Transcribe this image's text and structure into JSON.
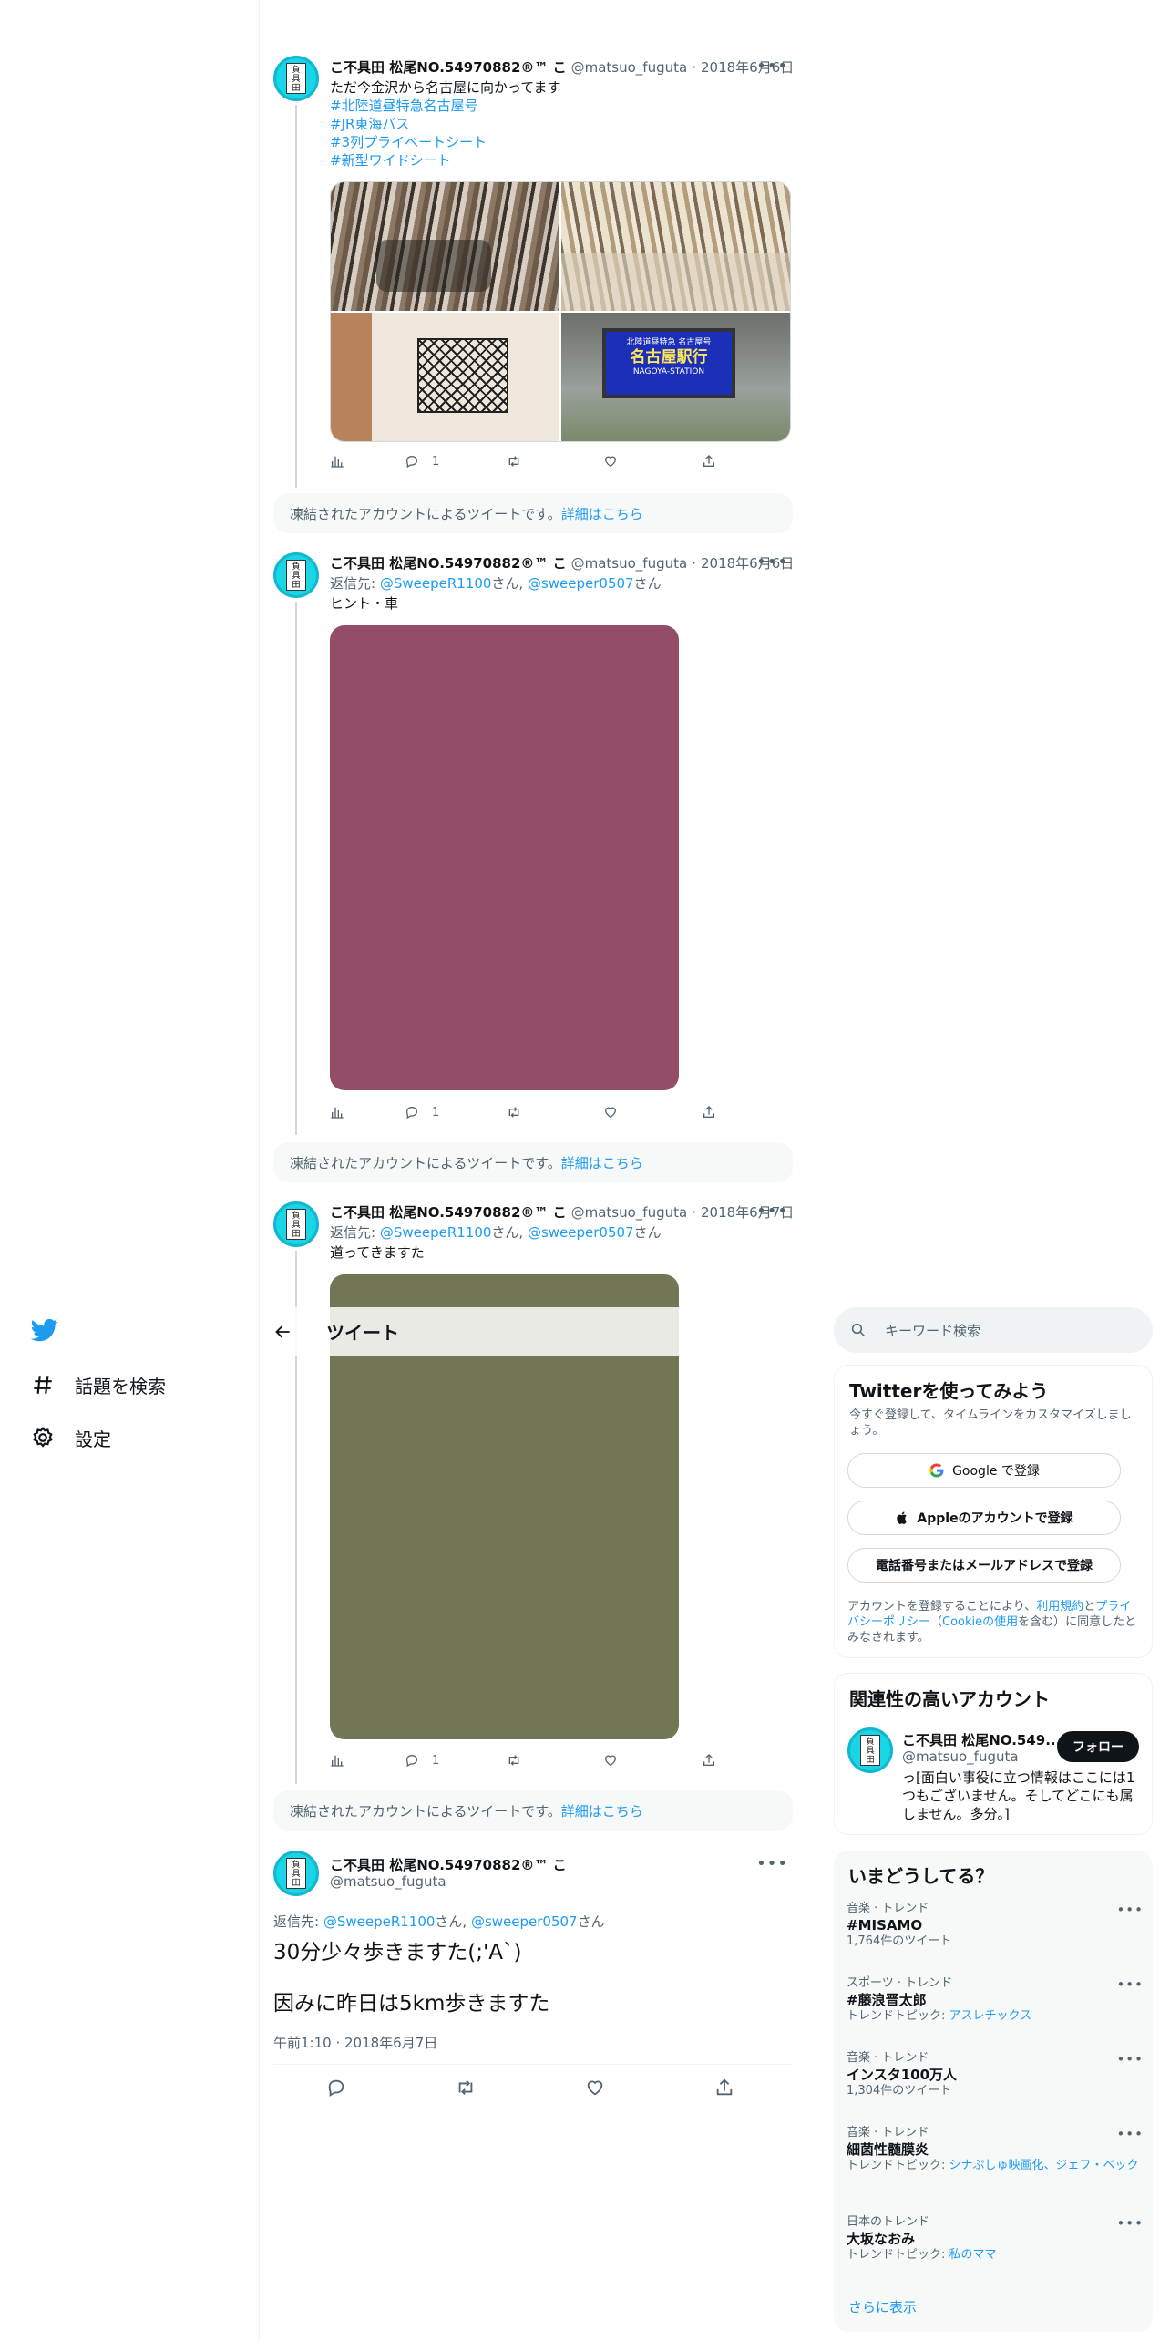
{
  "nav": {
    "items": [
      {
        "label": "話題を検索",
        "icon": "hashtag-icon"
      },
      {
        "label": "設定",
        "icon": "gear-icon"
      }
    ]
  },
  "header": {
    "title": "ツイート"
  },
  "tweets": [
    {
      "name": "こ不具田 松尾NO.54970882®™ こ",
      "handle": "@matsuo_fuguta",
      "dot": "·",
      "date": "2018年6月6日",
      "text": "ただ今金沢から名古屋に向かってます",
      "hashtags": [
        "#北陸道昼特急名古屋号",
        "#JR東海バス",
        "#3列プライベートシート",
        "#新型ワイドシート"
      ],
      "sign_lines": [
        "北陸道昼特急 名古屋号",
        "名古屋駅行",
        "NAGOYA-STATION"
      ],
      "reply_count": "1"
    },
    {
      "name": "こ不具田 松尾NO.54970882®™ こ",
      "handle": "@matsuo_fuguta",
      "dot": "·",
      "date": "2018年6月6日",
      "reply_prefix": "返信先: ",
      "reply_user1": "@SweepeR1100",
      "reply_mid": "さん, ",
      "reply_user2": "@sweeper0507",
      "reply_suffix": "さん",
      "text": "ヒント・車",
      "media_color": "#944d66",
      "reply_count": "1"
    },
    {
      "name": "こ不具田 松尾NO.54970882®™ こ",
      "handle": "@matsuo_fuguta",
      "dot": "·",
      "date": "2018年6月7日",
      "reply_prefix": "返信先: ",
      "reply_user1": "@SweepeR1100",
      "reply_mid": "さん, ",
      "reply_user2": "@sweeper0507",
      "reply_suffix": "さん",
      "text": "道ってきますた",
      "media_color": "#727654",
      "reply_count": "1"
    }
  ],
  "notice": {
    "text": "凍結されたアカウントによるツイートです。",
    "link": "詳細はこちら"
  },
  "focus": {
    "name": "こ不具田 松尾NO.54970882®™ こ",
    "handle": "@matsuo_fuguta",
    "reply_prefix": "返信先: ",
    "reply_user1": "@SweepeR1100",
    "reply_mid": "さん, ",
    "reply_user2": "@sweeper0507",
    "reply_suffix": "さん",
    "text1": "30分少々歩きますた(;'A`)",
    "text2": "因みに昨日は5km歩きますた",
    "time": "午前1:10 · 2018年6月7日"
  },
  "search": {
    "placeholder": "キーワード検索"
  },
  "signup": {
    "title": "Twitterを使ってみよう",
    "desc": "今すぐ登録して、タイムラインをカスタマイズしましょう。",
    "google": "Google で登録",
    "apple": "Appleのアカウントで登録",
    "phone": "電話番号またはメールアドレスで登録",
    "terms_a": "アカウントを登録することにより、",
    "terms_link1": "利用規約",
    "terms_b": "と",
    "terms_link2": "プライバシーポリシー",
    "terms_c": "（",
    "terms_link3": "Cookieの使用",
    "terms_d": "を含む）に同意したとみなされます。"
  },
  "related": {
    "title": "関連性の高いアカウント",
    "name": "こ不具田 松尾NO.549...",
    "handle": "@matsuo_fuguta",
    "follow": "フォロー",
    "bio": "っ[面白い事役に立つ情報はここには1つもございません。そしてどこにも属しません。多分。]"
  },
  "trends": {
    "title": "いまどうしてる？",
    "items": [
      {
        "meta": "音楽 · トレンド",
        "name": "#MISAMO",
        "sub": "1,764件のツイート",
        "sub_link": ""
      },
      {
        "meta": "スポーツ · トレンド",
        "name": "#藤浪晋太郎",
        "sub": "トレンドトピック: ",
        "sub_link": "アスレチックス"
      },
      {
        "meta": "音楽 · トレンド",
        "name": "インスタ100万人",
        "sub": "1,304件のツイート",
        "sub_link": ""
      },
      {
        "meta": "音楽 · トレンド",
        "name": "細菌性髄膜炎",
        "sub": "トレンドトピック: ",
        "sub_link": "シナぷしゅ映画化、ジェフ・ベック"
      },
      {
        "meta": "日本のトレンド",
        "name": "大坂なおみ",
        "sub": "トレンドトピック: ",
        "sub_link": "私のママ"
      }
    ],
    "more": "さらに表示"
  },
  "colors": {
    "accent": "#1d9bf0",
    "text": "#0f1419",
    "muted": "#536471",
    "avatar": "#1ad5e6"
  }
}
